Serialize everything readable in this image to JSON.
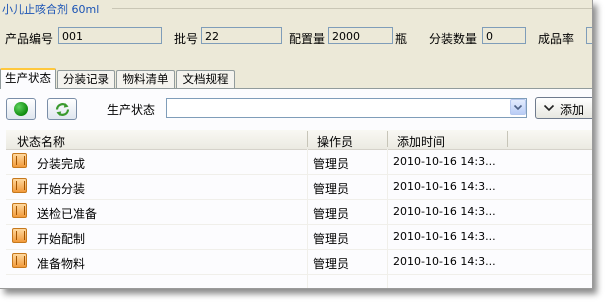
{
  "window": {
    "title": "小儿止咳合剂 60ml"
  },
  "fields": [
    {
      "label": "产品编号",
      "value": "001"
    },
    {
      "label": "批号",
      "value": "22"
    },
    {
      "label": "配置量",
      "value": "2000",
      "unit": "瓶"
    },
    {
      "label": "分装数量",
      "value": "0"
    },
    {
      "label": "成品率",
      "value": ""
    }
  ],
  "tabs": [
    {
      "label": "生产状态",
      "active": true
    },
    {
      "label": "分装记录",
      "active": false
    },
    {
      "label": "物料清单",
      "active": false
    },
    {
      "label": "文档规程",
      "active": false
    }
  ],
  "toolbar": {
    "start_icon": "green-circle-icon",
    "refresh_icon": "refresh-icon",
    "status_label": "生产状态",
    "status_value": "",
    "add_label": "添加",
    "add_icon": "chevron-down-icon"
  },
  "grid": {
    "columns": [
      "状态名称",
      "操作员",
      "添加时间"
    ],
    "rows": [
      {
        "name": "分装完成",
        "operator": "管理员",
        "time": "2010-10-16 14:3..."
      },
      {
        "name": "开始分装",
        "operator": "管理员",
        "time": "2010-10-16 14:3..."
      },
      {
        "name": "送检已准备",
        "operator": "管理员",
        "time": "2010-10-16 14:3..."
      },
      {
        "name": "开始配制",
        "operator": "管理员",
        "time": "2010-10-16 14:3..."
      },
      {
        "name": "准备物料",
        "operator": "管理员",
        "time": "2010-10-16 14:3..."
      }
    ]
  },
  "colors": {
    "title": "#1a53b5",
    "active_tab_accent": "#ffc83c",
    "background": "#ece9d8"
  }
}
